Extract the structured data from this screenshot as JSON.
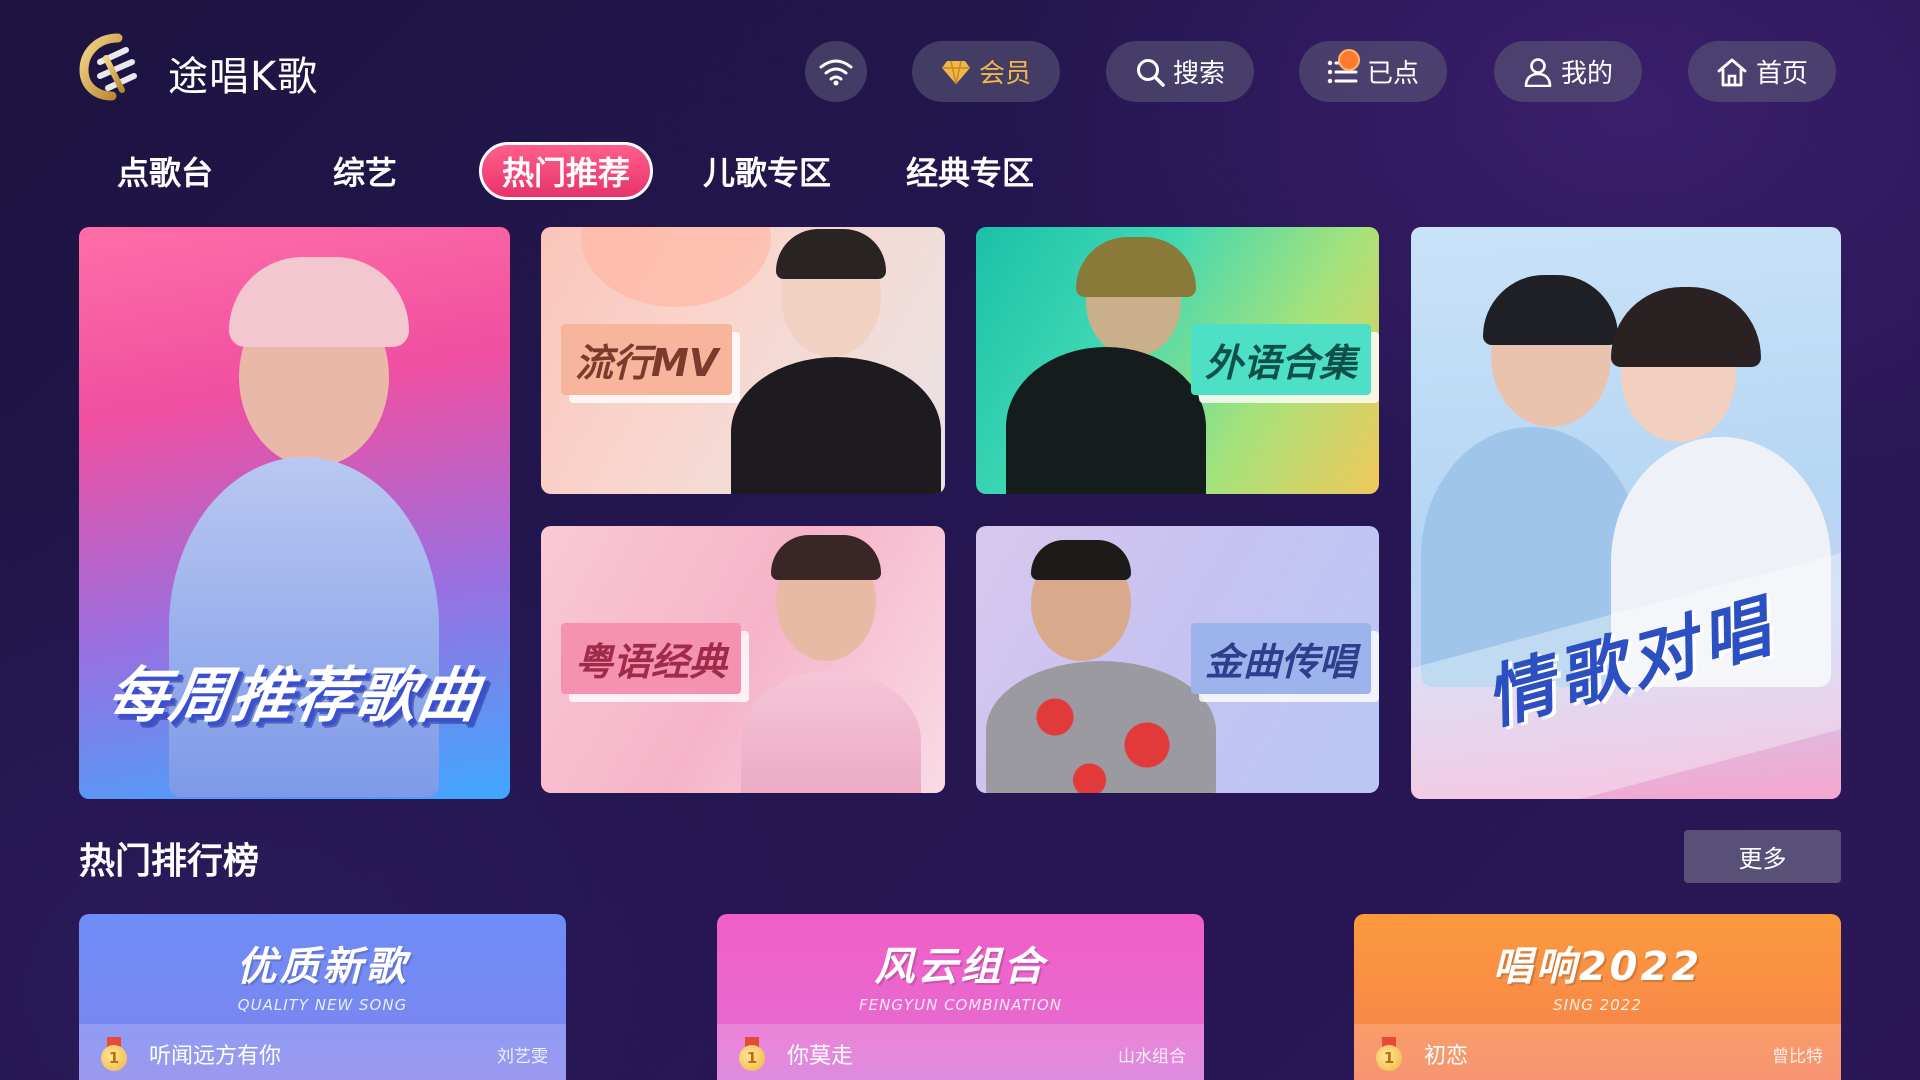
{
  "app": {
    "title": "途唱K歌"
  },
  "header": {
    "vip_label": "会员",
    "search_label": "搜索",
    "queue_label": "已点",
    "mine_label": "我的",
    "home_label": "首页",
    "accent_vip": "#f0b64a"
  },
  "tabs": [
    {
      "label": "点歌台",
      "active": false
    },
    {
      "label": "综艺",
      "active": false
    },
    {
      "label": "热门推荐",
      "active": true
    },
    {
      "label": "儿歌专区",
      "active": false
    },
    {
      "label": "经典专区",
      "active": false
    }
  ],
  "cards": {
    "weekly": "每周推荐歌曲",
    "pop": "流行MV",
    "foreign": "外语合集",
    "cantonese": "粤语经典",
    "golden": "金曲传唱",
    "duet": "情歌对唱"
  },
  "ranking": {
    "title": "热门排行榜",
    "more_label": "更多",
    "lists": [
      {
        "title": "优质新歌",
        "subtitle": "QUALITY NEW SONG",
        "top_song": "听闻远方有你",
        "top_singer": "刘艺雯",
        "rank": "1"
      },
      {
        "title": "风云组合",
        "subtitle": "FENGYUN COMBINATION",
        "top_song": "你莫走",
        "top_singer": "山水组合",
        "rank": "1"
      },
      {
        "title": "唱响2022",
        "subtitle": "SING 2022",
        "top_song": "初恋",
        "top_singer": "曾比特",
        "rank": "1"
      }
    ]
  },
  "colors": {
    "active_tab": "#e8336a",
    "background": "#241651"
  }
}
